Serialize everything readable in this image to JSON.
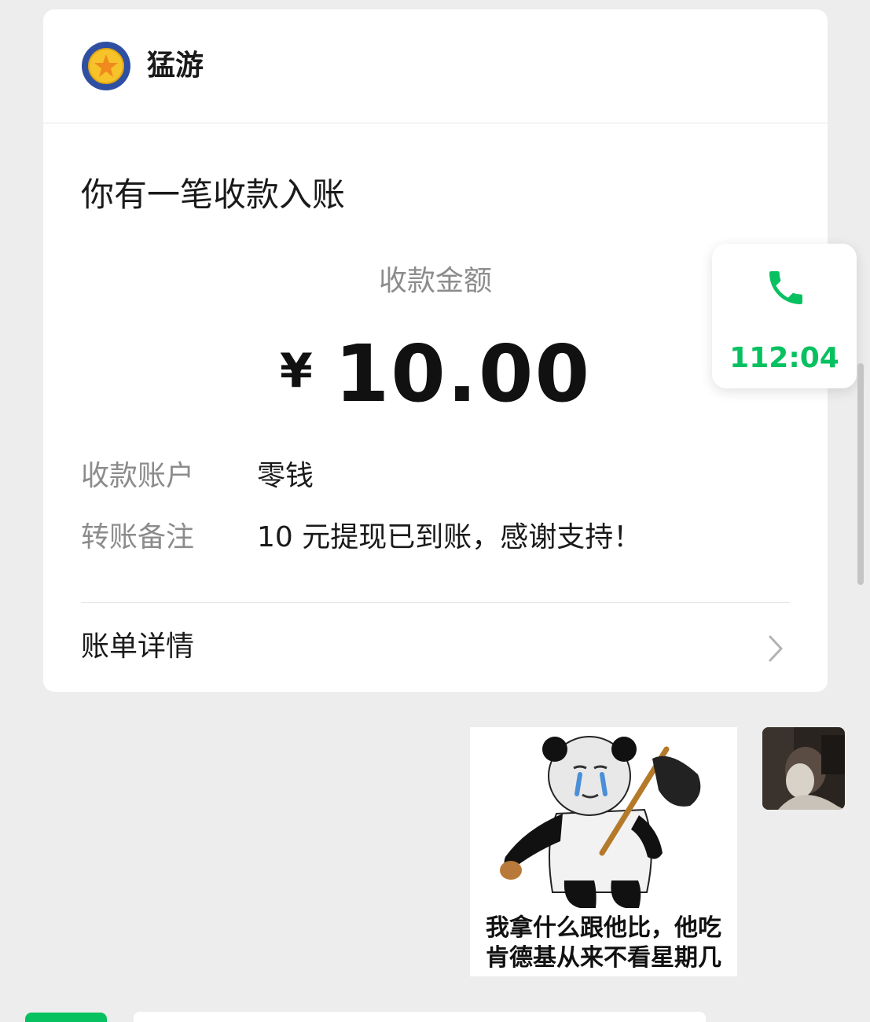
{
  "header": {
    "app_name": "猛游"
  },
  "notice": {
    "title": "你有一笔收款入账",
    "amount_label": "收款金额",
    "currency": "¥",
    "amount": "10.00"
  },
  "details": [
    {
      "label": "收款账户",
      "value": "零钱"
    },
    {
      "label": "转账备注",
      "value": "10 元提现已到账，感谢支持！"
    }
  ],
  "bill": {
    "label": "账单详情"
  },
  "call": {
    "timer": "112:04",
    "icon": "phone-icon",
    "color": "#07c160"
  },
  "sticker": {
    "caption_line1": "我拿什么跟他比，他吃",
    "caption_line2": "肯德基从来不看星期几"
  },
  "colors": {
    "accent": "#07c160",
    "background": "#ededed"
  }
}
